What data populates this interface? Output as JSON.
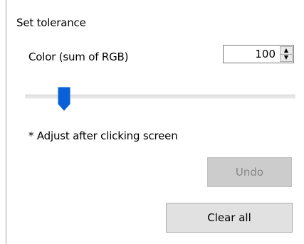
{
  "group": {
    "title": "Set tolerance"
  },
  "tolerance": {
    "label": "Color (sum of RGB)",
    "value": "100",
    "slider_fraction": 0.14
  },
  "note": "* Adjust after clicking screen",
  "buttons": {
    "undo_label": "Undo",
    "clear_label": "Clear all"
  },
  "icons": {
    "spin_up": "up-arrow-icon",
    "spin_down": "down-arrow-icon",
    "slider_thumb": "slider-thumb-icon"
  },
  "colors": {
    "thumb": "#0a60d8",
    "disabled_button": "#cccccc",
    "button": "#e1e1e1"
  }
}
